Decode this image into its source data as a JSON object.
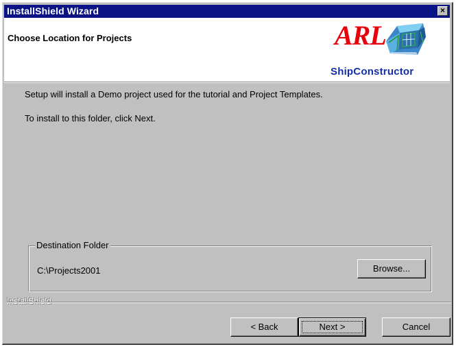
{
  "window": {
    "title": "InstallShield Wizard",
    "close_glyph": "×"
  },
  "header": {
    "title": "Choose Location for Projects",
    "logo": {
      "brand": "ARL",
      "product": "ShipConstructor",
      "brand_color": "#e8000a",
      "product_color": "#152ea8"
    }
  },
  "body": {
    "line1": "Setup will install a Demo project used for the tutorial and Project Templates.",
    "line2": "To install to this folder, click Next."
  },
  "destination": {
    "label": "Destination Folder",
    "path": "C:\\Projects2001",
    "browse_label": "Browse..."
  },
  "footer": {
    "brand": "InstallShield",
    "back_label": "< Back",
    "next_label": "Next >",
    "cancel_label": "Cancel"
  },
  "colors": {
    "titlebar": "#0a1484",
    "dialog_bg": "#c0c0c0",
    "header_bg": "#ffffff"
  }
}
